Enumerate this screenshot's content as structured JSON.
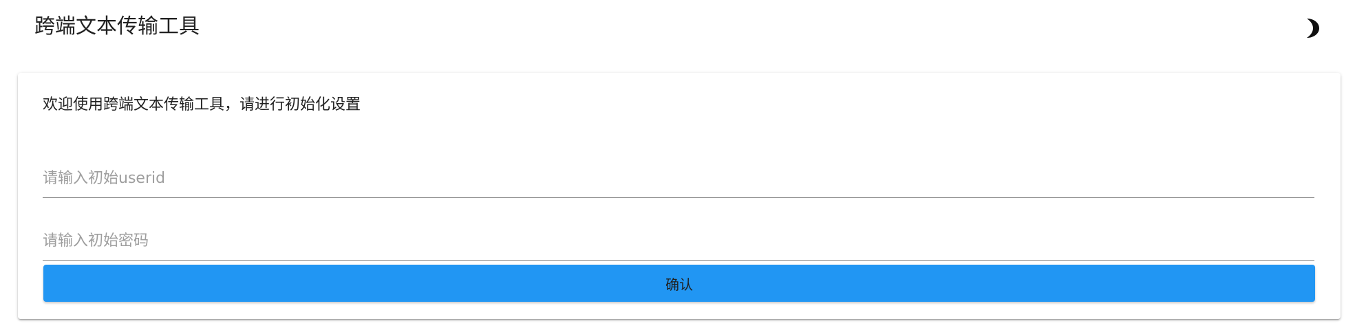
{
  "app": {
    "title": "跨端文本传输工具",
    "theme_toggle_icon": "moon-icon"
  },
  "setup_card": {
    "welcome_text": "欢迎使用跨端文本传输工具，请进行初始化设置",
    "userid_field": {
      "value": "",
      "placeholder": "请输入初始userid"
    },
    "password_field": {
      "value": "",
      "placeholder": "请输入初始密码"
    },
    "confirm_label": "确认"
  },
  "colors": {
    "primary": "#2196f3",
    "text": "#212121",
    "placeholder": "#9e9e9e"
  }
}
